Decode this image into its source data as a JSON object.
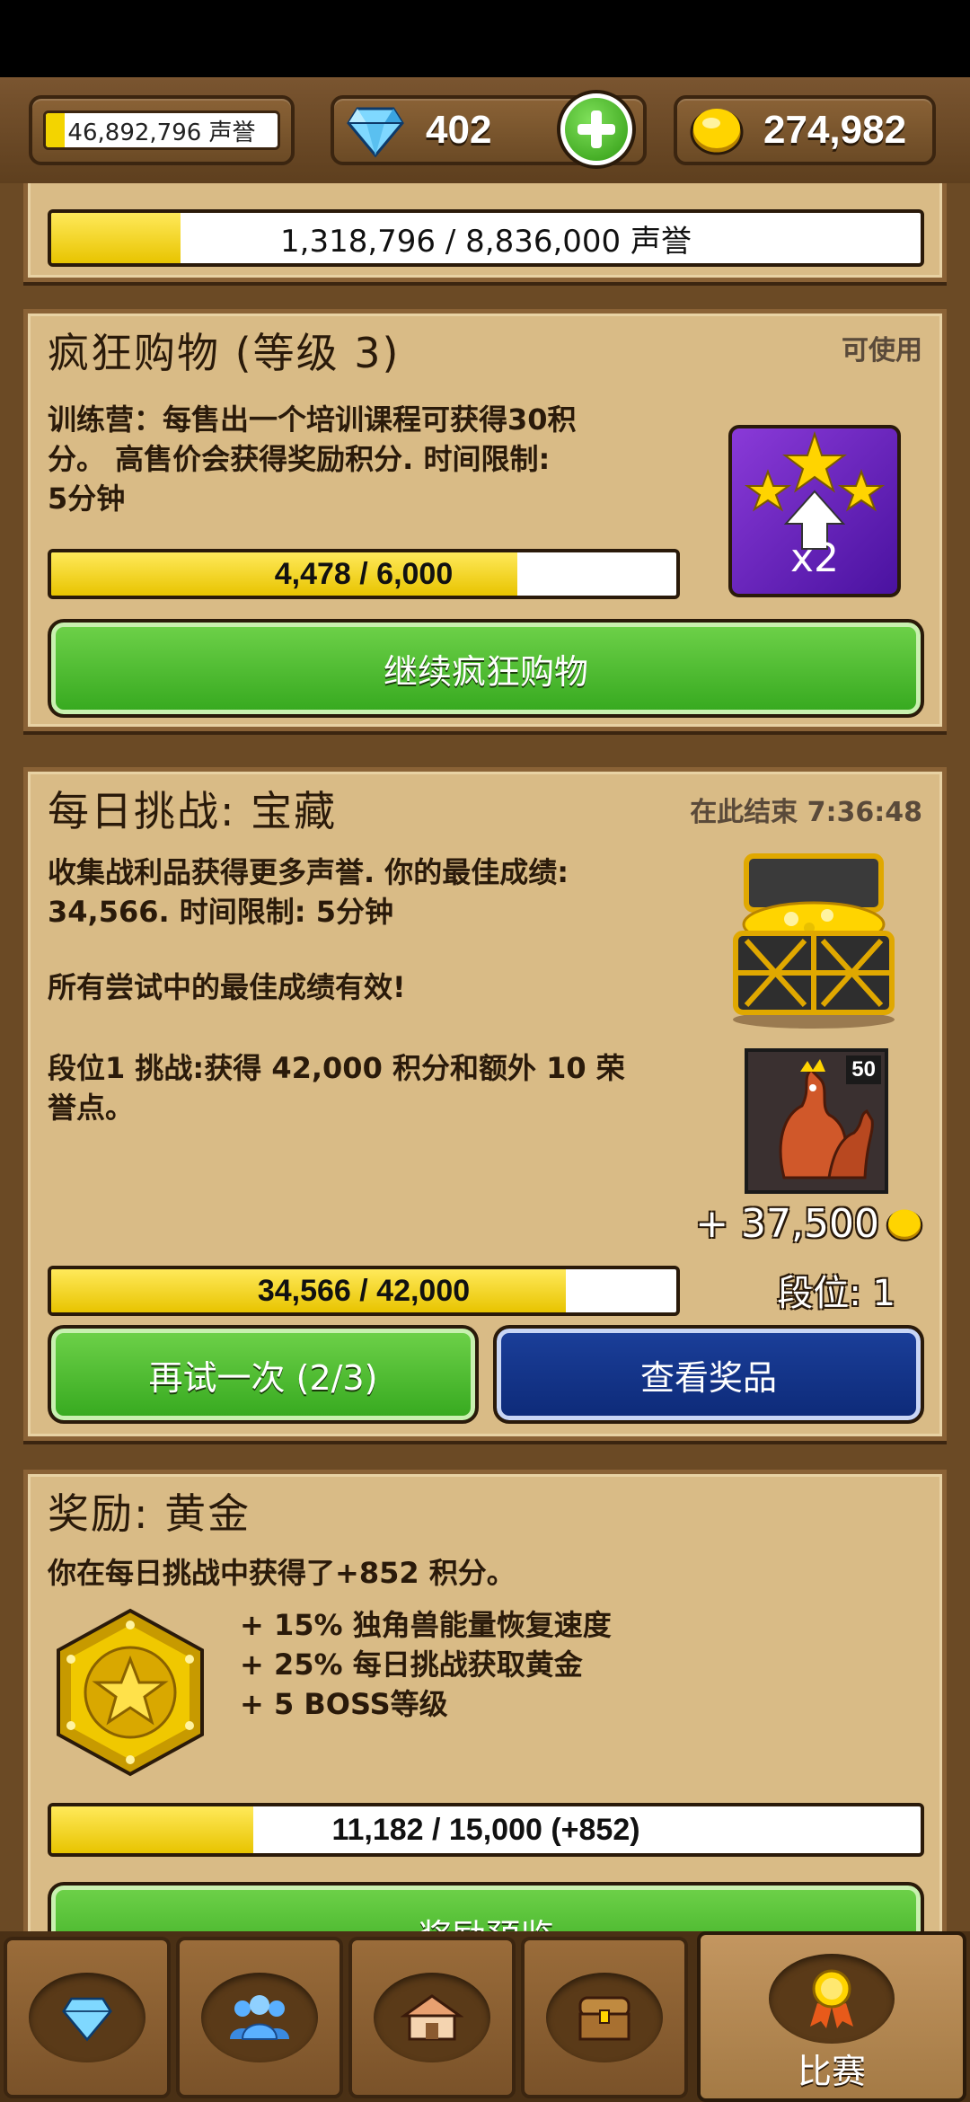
{
  "topbar": {
    "fame_value": "46,892,796 声誉",
    "fame_fill": 0.08,
    "gems": "402",
    "gold": "274,982"
  },
  "reputation": {
    "progress_text": "1,318,796 / 8,836,000 声誉",
    "progress": 0.149
  },
  "shopping": {
    "title": "疯狂购物 (等级 3)",
    "status": "可使用",
    "desc_lines": [
      "训练营：每售出一个培训课程可获得30积",
      "分。 高售价会获得奖励积分. 时间限制:",
      "5分钟"
    ],
    "badge_text": "x2",
    "progress_text": "4,478 / 6,000",
    "progress": 0.746,
    "button_label": "继续疯狂购物"
  },
  "daily": {
    "title": "每日挑战: 宝藏",
    "ends_label": "在此结束 7:36:48",
    "desc_lines": [
      "收集战利品获得更多声誉. 你的最佳成绩:",
      "34,566. 时间限制: 5分钟"
    ],
    "note": "所有尝试中的最佳成绩有效!",
    "tier_lines": [
      "段位1 挑战:获得 42,000 积分和额外 10 荣",
      "誉点。"
    ],
    "card_level": "50",
    "reward_gold": "+ 37,500",
    "rank_label": "段位: 1",
    "progress_text": "34,566 / 42,000",
    "progress": 0.823,
    "retry_label": "再试一次 (2/3)",
    "view_prizes_label": "查看奖品"
  },
  "reward": {
    "title": "奖励: 黄金",
    "desc": "你在每日挑战中获得了+852 积分。",
    "perks": [
      "+ 15% 独角兽能量恢复速度",
      "+ 25% 每日挑战获取黄金",
      "+ 5 BOSS等级"
    ],
    "progress_text": "11,182 / 15,000 (+852)",
    "progress": 0.232,
    "preview_label": "奖励预览"
  },
  "nav": {
    "active_label": "比赛"
  },
  "colors": {
    "accent_yellow": "#f3d400",
    "button_green": "#35a81e",
    "button_blue": "#0d2a78",
    "panel_bg": "#d9bb86"
  }
}
